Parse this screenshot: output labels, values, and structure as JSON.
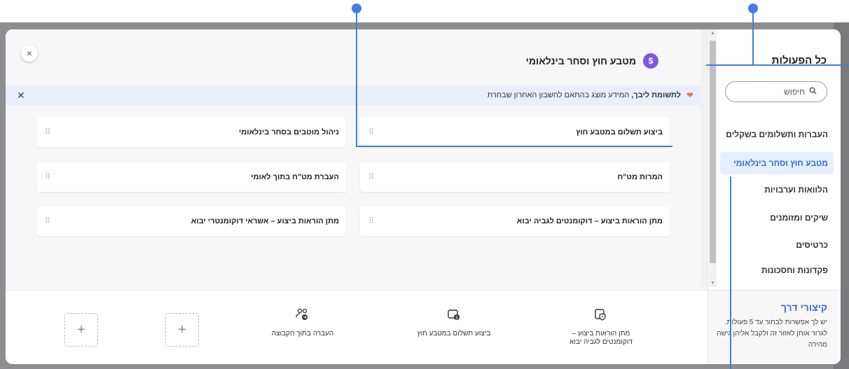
{
  "sidebar": {
    "title": "כל הפעולות",
    "search_placeholder": "חיפוש",
    "items": [
      {
        "label": "העברות ותשלומים בשקלים"
      },
      {
        "label": "מטבע חוץ וסחר בינלאומי"
      },
      {
        "label": "הלוואות וערבויות"
      },
      {
        "label": "שיקים ומזומנים"
      },
      {
        "label": "כרטיסים"
      },
      {
        "label": "פקדונות וחסכונות"
      }
    ],
    "shortcuts": {
      "title": "קיצורי דרך",
      "description": "יש לך אפשרות לבחור עד 5 פעולות. לגרור אותן לאזור זה ולקבל אליהן גישה מהירה"
    }
  },
  "main": {
    "close_icon": "×",
    "header": {
      "title": "מטבע חוץ וסחר בינלאומי",
      "icon": "dollar-icon",
      "icon_glyph": "$"
    },
    "notice": {
      "bold": "לתשומת ליבך,",
      "text": "המידע מוצג בהתאם לחשבון האחרון שבחרת",
      "close": "✕"
    },
    "cards": [
      {
        "label": "ביצוע תשלום במטבע חוץ"
      },
      {
        "label": "ניהול מוטבים בסחר בינלאומי"
      },
      {
        "label": "המרות מט\"ח"
      },
      {
        "label": "העברת מט\"ח בתוך לאומי"
      },
      {
        "label": "מתן הוראות ביצוע – דוקומנטים לגביה יבוא"
      },
      {
        "label": "מתן הוראות ביצוע – אשראי דוקומנטרי יבוא"
      }
    ],
    "shortcuts_bar": [
      {
        "label": "מתן הוראות ביצוע – דוקומנטים לגביה יבוא",
        "icon": "document-shield-icon"
      },
      {
        "label": "ביצוע תשלום במטבע חוץ",
        "icon": "wallet-coin-icon"
      },
      {
        "label": "העברה בתוך הקבוצה",
        "icon": "group-transfer-icon"
      }
    ],
    "add_slot_label": "+"
  },
  "colors": {
    "accent": "#3d7fe6",
    "active_bg": "#e6efff",
    "dollar_icon": "#7e57e0"
  }
}
